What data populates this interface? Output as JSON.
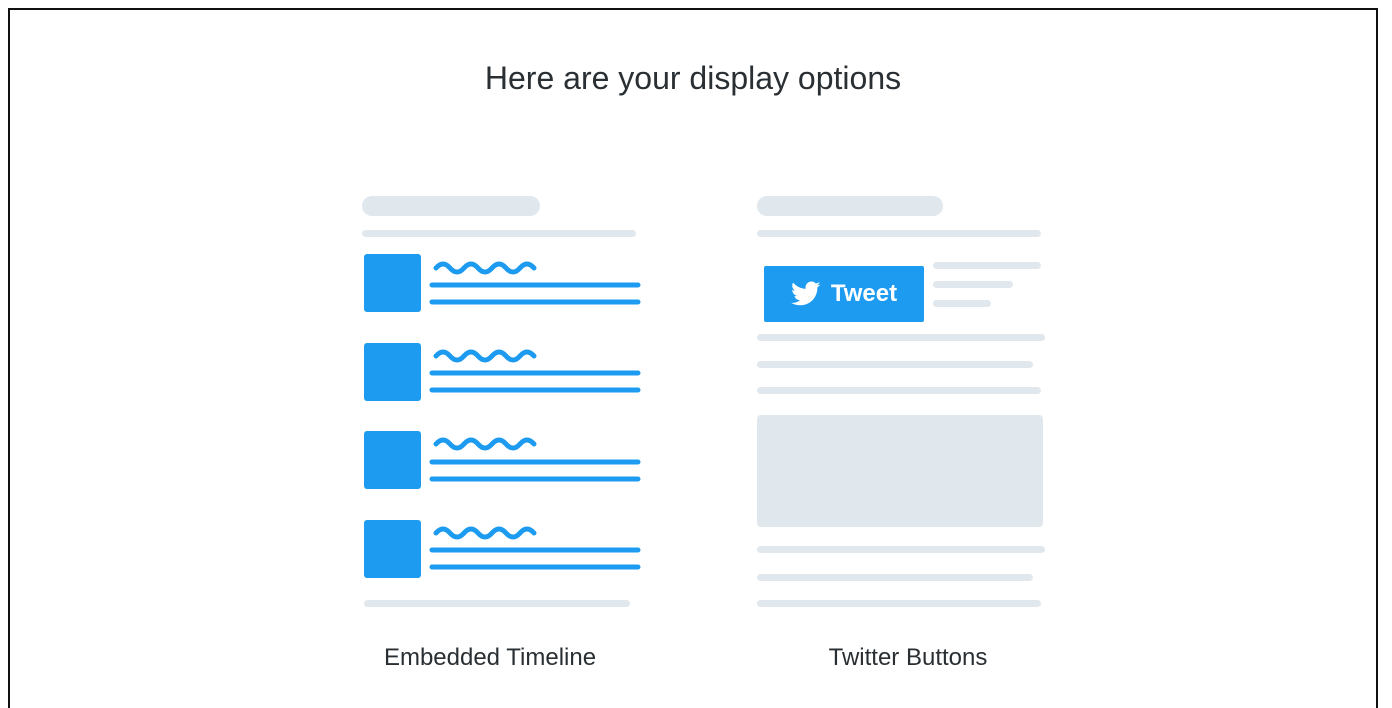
{
  "heading": "Here are your display options",
  "options": [
    {
      "label": "Embedded Timeline",
      "icon": "timeline-illustration-icon"
    },
    {
      "label": "Twitter Buttons",
      "icon": "buttons-illustration-icon",
      "button_label": "Tweet"
    }
  ],
  "colors": {
    "accent": "#1d9bf0",
    "placeholder": "#e1e8ed",
    "text": "#292f33"
  }
}
